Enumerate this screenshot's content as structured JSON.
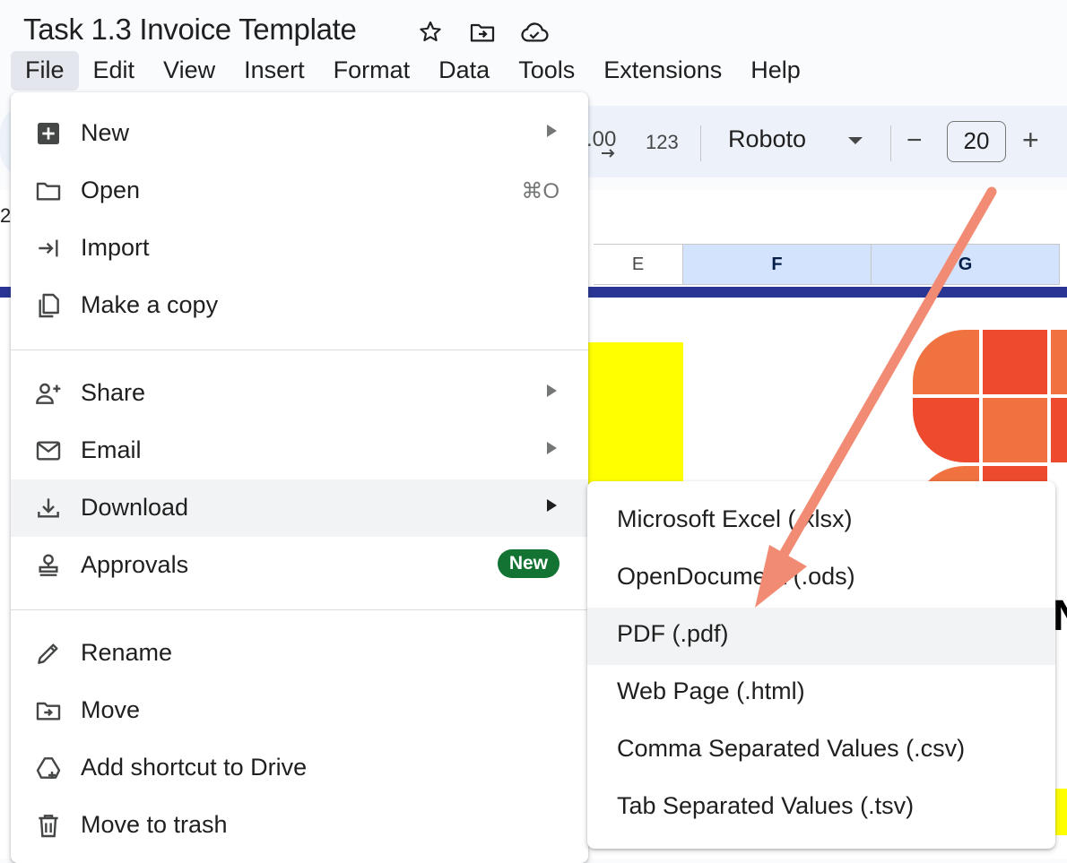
{
  "doc": {
    "title": "Task 1.3 Invoice Template"
  },
  "title_icons": [
    "star-icon",
    "move-folder-icon",
    "cloud-saved-icon"
  ],
  "menubar": {
    "items": [
      "File",
      "Edit",
      "View",
      "Insert",
      "Format",
      "Data",
      "Tools",
      "Extensions",
      "Help"
    ],
    "active": "File"
  },
  "toolbar": {
    "decimal_label": ".00",
    "number_format_label": "123",
    "font_name": "Roboto",
    "decrease_label": "−",
    "font_size": "20",
    "increase_label": "+"
  },
  "sheet": {
    "column_headers": [
      "E",
      "F",
      "G"
    ],
    "selected_columns": [
      "F",
      "G"
    ],
    "row_cut_label": "2",
    "partial_text": "N"
  },
  "file_menu": {
    "items": [
      {
        "label": "New",
        "icon": "new-sheet-icon",
        "submenu": true
      },
      {
        "label": "Open",
        "icon": "folder-open-icon",
        "shortcut": "⌘O"
      },
      {
        "label": "Import",
        "icon": "import-icon"
      },
      {
        "label": "Make a copy",
        "icon": "copy-icon"
      },
      {
        "label": "Share",
        "icon": "share-person-icon",
        "submenu": true
      },
      {
        "label": "Email",
        "icon": "email-icon",
        "submenu": true
      },
      {
        "label": "Download",
        "icon": "download-icon",
        "submenu": true,
        "highlighted": true
      },
      {
        "label": "Approvals",
        "icon": "approvals-stamp-icon",
        "badge": "New"
      },
      {
        "label": "Rename",
        "icon": "pencil-icon"
      },
      {
        "label": "Move",
        "icon": "move-folder-icon"
      },
      {
        "label": "Add shortcut to Drive",
        "icon": "drive-shortcut-icon"
      },
      {
        "label": "Move to trash",
        "icon": "trash-icon"
      }
    ]
  },
  "download_submenu": {
    "items": [
      {
        "label": "Microsoft Excel (.xlsx)"
      },
      {
        "label": "OpenDocument (.ods)"
      },
      {
        "label": "PDF (.pdf)",
        "highlighted": true
      },
      {
        "label": "Web Page (.html)"
      },
      {
        "label": "Comma Separated Values (.csv)"
      },
      {
        "label": "Tab Separated Values (.tsv)"
      }
    ]
  },
  "colors": {
    "menu_highlight": "#f1f3f4",
    "badge_green": "#137333",
    "annotation_arrow": "#f28b73",
    "header_strip_navy": "#283593",
    "sheet_yellow": "#ffff00",
    "logo_orange": "#f07241",
    "logo_red": "#ee4a2e"
  }
}
